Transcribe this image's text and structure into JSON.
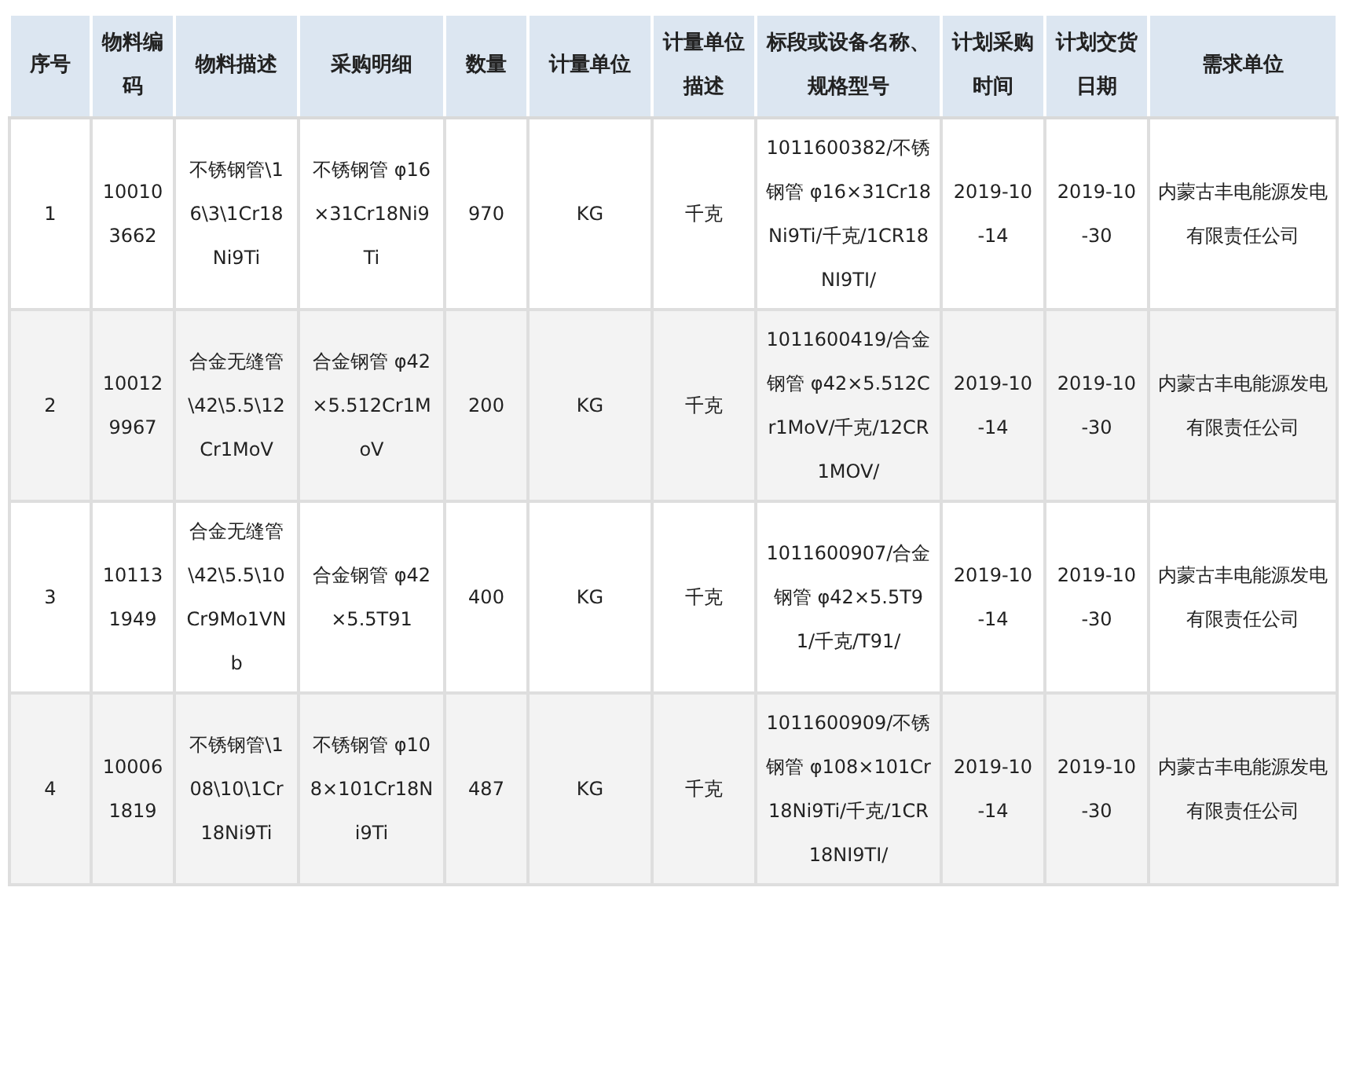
{
  "table": {
    "columns": [
      "序号",
      "物料编码",
      "物料描述",
      "采购明细",
      "数量",
      "计量单位",
      "计量单位描述",
      "标段或设备名称、规格型号",
      "计划采购时间",
      "计划交货日期",
      "需求单位"
    ],
    "rows": [
      [
        "1",
        "100103662",
        "不锈钢管\\16\\3\\1Cr18Ni9Ti",
        "不锈钢管 φ16×31Cr18Ni9Ti",
        "970",
        "KG",
        "千克",
        "1011600382/不锈钢管 φ16×31Cr18Ni9Ti/千克/1CR18NI9TI/",
        "2019-10-14",
        "2019-10-30",
        "内蒙古丰电能源发电有限责任公司"
      ],
      [
        "2",
        "100129967",
        "合金无缝管\\42\\5.5\\12Cr1MoV",
        "合金钢管 φ42×5.512Cr1MoV",
        "200",
        "KG",
        "千克",
        "1011600419/合金钢管 φ42×5.512Cr1MoV/千克/12CR1MOV/",
        "2019-10-14",
        "2019-10-30",
        "内蒙古丰电能源发电有限责任公司"
      ],
      [
        "3",
        "101131949",
        "合金无缝管\\42\\5.5\\10Cr9Mo1VNb",
        "合金钢管 φ42×5.5T91",
        "400",
        "KG",
        "千克",
        "1011600907/合金钢管 φ42×5.5T91/千克/T91/",
        "2019-10-14",
        "2019-10-30",
        "内蒙古丰电能源发电有限责任公司"
      ],
      [
        "4",
        "100061819",
        "不锈钢管\\108\\10\\1Cr18Ni9Ti",
        "不锈钢管 φ108×101Cr18Ni9Ti",
        "487",
        "KG",
        "千克",
        "1011600909/不锈钢管 φ108×101Cr18Ni9Ti/千克/1CR18NI9TI/",
        "2019-10-14",
        "2019-10-30",
        "内蒙古丰电能源发电有限责任公司"
      ]
    ]
  }
}
